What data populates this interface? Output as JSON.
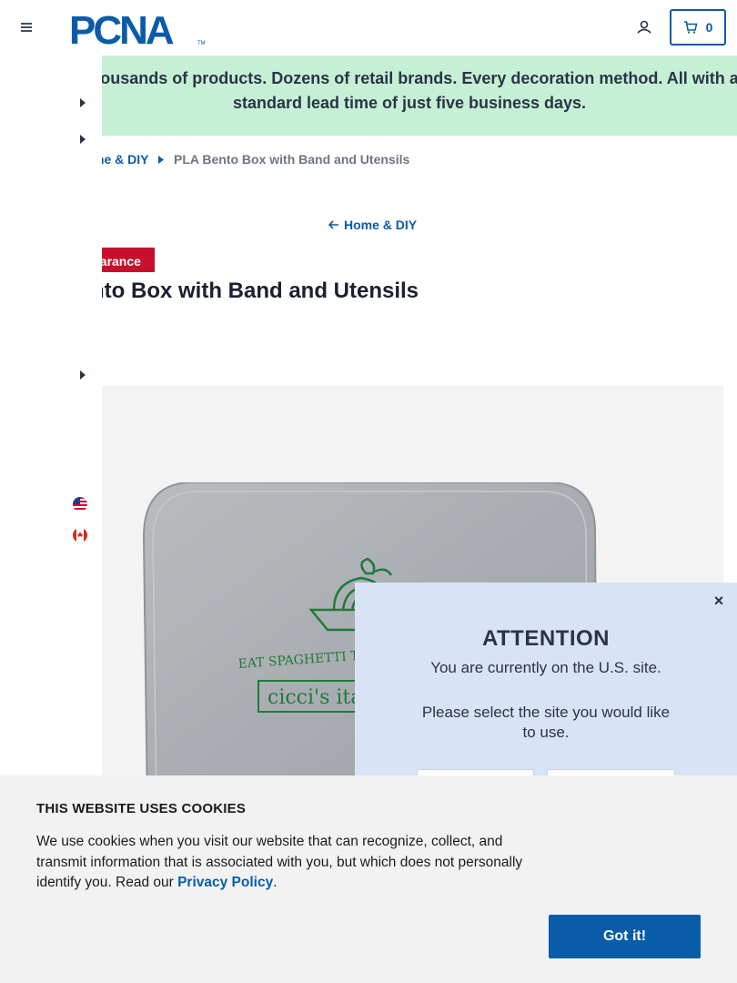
{
  "header": {
    "logo_text": "PCNA",
    "cart_count": "0"
  },
  "banner": {
    "text": "Thousands of products. Dozens of retail brands. Every decoration method. All with a standard lead time of just five business days."
  },
  "breadcrumb": {
    "parent": "me & DIY",
    "current": "PLA Bento Box with Band and Utensils"
  },
  "back_link": "Home & DIY",
  "badge": "Clearance",
  "product": {
    "title": "nto Box with Band and Utensils",
    "image_text": [
      "EAT SPAGHETTI TO FO",
      "cicci's ita"
    ]
  },
  "modal": {
    "close": "×",
    "title": "ATTENTION",
    "text1": "You are currently on the U.S. site.",
    "text2": "Please select the site you would like to use."
  },
  "cookie": {
    "title": "THIS WEBSITE USES COOKIES",
    "body": "We use cookies when you visit our website that can recognize, collect, and transmit information that is associated with you, but which does not personally identify you. Read our ",
    "link": "Privacy Policy",
    "period": ".",
    "button": "Got it!"
  },
  "colors": {
    "brand_blue": "#0b5ca8",
    "banner_green": "#c5f0d6",
    "badge_red": "#c8102e",
    "modal_bg": "#d9e3f6",
    "cookie_bg": "#f2f2f2"
  }
}
